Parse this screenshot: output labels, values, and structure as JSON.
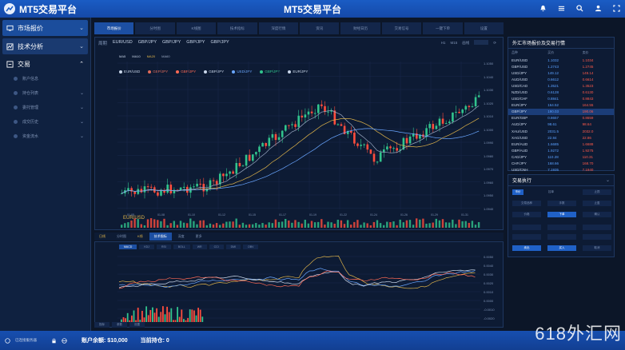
{
  "app": {
    "brand": "MT5交易平台",
    "window_title": "MT5交易平台"
  },
  "sidebar": {
    "market": "市场报价",
    "analysis": "技术分析",
    "trade": "交易",
    "sub_items": [
      "账户信息",
      "持仓列表",
      "委托管理",
      "成交历史",
      "资金流水"
    ]
  },
  "tabs": [
    "市场报价",
    "分时图",
    "K线图",
    "技术指标",
    "深度行情",
    "资讯",
    "财经日历",
    "交易信号",
    "一键下单",
    "设置"
  ],
  "chart": {
    "pairs": [
      "EUR/USD",
      "GBP/JPY",
      "GBP/JPY",
      "GBP/JPY",
      "GBP/JPY"
    ],
    "controls": [
      "周期",
      "H1",
      "M15",
      "画线",
      "指标"
    ],
    "legend_ma": [
      "MA5",
      "MA10",
      "MA20",
      "MA60"
    ],
    "legend_series": [
      "EUR/USD",
      "GBP/JPY",
      "GBP/JPY",
      "GBP/JPY",
      "USD/JPY",
      "GBP/JPY",
      "EUR/JPY"
    ],
    "symbol": "EUR/USD",
    "y_labels": [
      "1.1050",
      "1.1040",
      "1.1030",
      "1.1020",
      "1.1010",
      "1.1000",
      "1.0990",
      "1.0980",
      "1.0970",
      "1.0960",
      "1.0950",
      "1.0940"
    ],
    "x_labels": [
      "01-05",
      "01-08",
      "01-10",
      "01-12",
      "01-15",
      "01-17",
      "01-19",
      "01-22",
      "01-24",
      "01-26",
      "01-29",
      "01-31"
    ],
    "bottom_tabs": [
      "日线",
      "分时图",
      "K线",
      "技术指标",
      "深度",
      "更多"
    ]
  },
  "chart_data": {
    "type": "line",
    "title": "",
    "series_colors": [
      "#31c48d",
      "#ff4d3d",
      "#e0b44a",
      "#6aa6ff",
      "#9aa8c2"
    ]
  },
  "sub": {
    "tabs": [
      "MACD",
      "KDJ",
      "RSI",
      "BOLL",
      "WR",
      "CCI",
      "DMI",
      "OBV"
    ],
    "bottom_tabs": [
      "指标",
      "参数",
      "设置"
    ],
    "y_labels": [
      "0.0050",
      "0.0040",
      "0.0030",
      "0.0020",
      "0.0010",
      "0.0000",
      "-0.0010",
      "-0.0020"
    ]
  },
  "right_panel": {
    "title": "外汇市场报价及交易行情",
    "headers": [
      "品种",
      "买价",
      "卖价"
    ],
    "rows": [
      {
        "sym": "EUR/USD",
        "bid": "1.1032",
        "ask": "1.1034"
      },
      {
        "sym": "GBP/USD",
        "bid": "1.2743",
        "ask": "1.2745"
      },
      {
        "sym": "USD/JPY",
        "bid": "149.12",
        "ask": "149.14"
      },
      {
        "sym": "AUD/USD",
        "bid": "0.6612",
        "ask": "0.6614"
      },
      {
        "sym": "USD/CAD",
        "bid": "1.3521",
        "ask": "1.3523"
      },
      {
        "sym": "NZD/USD",
        "bid": "0.6128",
        "ask": "0.6130"
      },
      {
        "sym": "USD/CHF",
        "bid": "0.8841",
        "ask": "0.8843"
      },
      {
        "sym": "EUR/JPY",
        "bid": "164.52",
        "ask": "164.55"
      },
      {
        "sym": "GBP/JPY",
        "bid": "190.03",
        "ask": "190.06"
      },
      {
        "sym": "EUR/GBP",
        "bid": "0.8657",
        "ask": "0.8659"
      },
      {
        "sym": "AUD/JPY",
        "bid": "98.61",
        "ask": "98.64"
      },
      {
        "sym": "XAU/USD",
        "bid": "2031.5",
        "ask": "2032.0"
      },
      {
        "sym": "XAG/USD",
        "bid": "22.84",
        "ask": "22.86"
      },
      {
        "sym": "EUR/AUD",
        "bid": "1.6685",
        "ask": "1.6688"
      },
      {
        "sym": "GBP/AUD",
        "bid": "1.9272",
        "ask": "1.9275"
      },
      {
        "sym": "CAD/JPY",
        "bid": "110.28",
        "ask": "110.31"
      },
      {
        "sym": "CHF/JPY",
        "bid": "168.66",
        "ask": "168.70"
      },
      {
        "sym": "USD/CNH",
        "bid": "7.1935",
        "ask": "7.1940"
      }
    ]
  },
  "trade_panel": {
    "title": "交易执行",
    "buttons": [
      "市价",
      "挂单",
      "止损",
      "止盈",
      "交易品种",
      "手数",
      "下单",
      "价格",
      "确认",
      "卖出",
      "买入",
      "平仓",
      "取消"
    ]
  },
  "status": {
    "connection": "已连接服务器",
    "balance_label": "账户余额:",
    "balance": "$10,000",
    "position_label": "当前持仓:",
    "position": "0"
  },
  "watermark": "618外汇网"
}
